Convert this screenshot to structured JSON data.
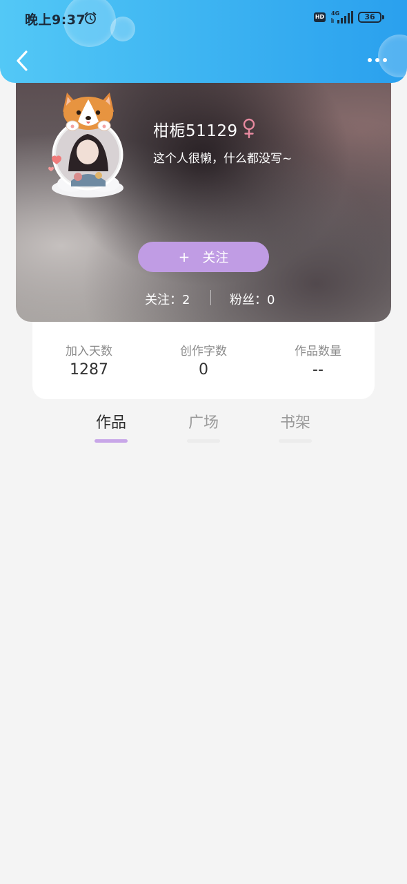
{
  "status_bar": {
    "time": "晚上9:37",
    "hd_label": "HD",
    "network": "4G",
    "battery": "36"
  },
  "header": {
    "back_icon": "chevron-left-icon",
    "more_icon": "more-horizontal-icon"
  },
  "profile": {
    "name": "柑栀51129",
    "gender_symbol": "♀",
    "bio": "这个人很懒，什么都没写~",
    "follow_button_plus": "+",
    "follow_button_label": "关注",
    "following_text": "关注：2",
    "fans_text": "粉丝：0"
  },
  "stats": [
    {
      "label": "加入天数",
      "value": "1287"
    },
    {
      "label": "创作字数",
      "value": "0"
    },
    {
      "label": "作品数量",
      "value": "--"
    }
  ],
  "tabs": [
    {
      "label": "作品",
      "active": true
    },
    {
      "label": "广场",
      "active": false
    },
    {
      "label": "书架",
      "active": false
    }
  ],
  "colors": {
    "header_gradient_start": "#53c8f6",
    "header_gradient_end": "#2aa0ee",
    "follow_button": "#c09ce4",
    "active_tab_indicator": "#c8a6e8",
    "gender_female": "#e88aa0",
    "page_background": "#f4f4f4"
  }
}
